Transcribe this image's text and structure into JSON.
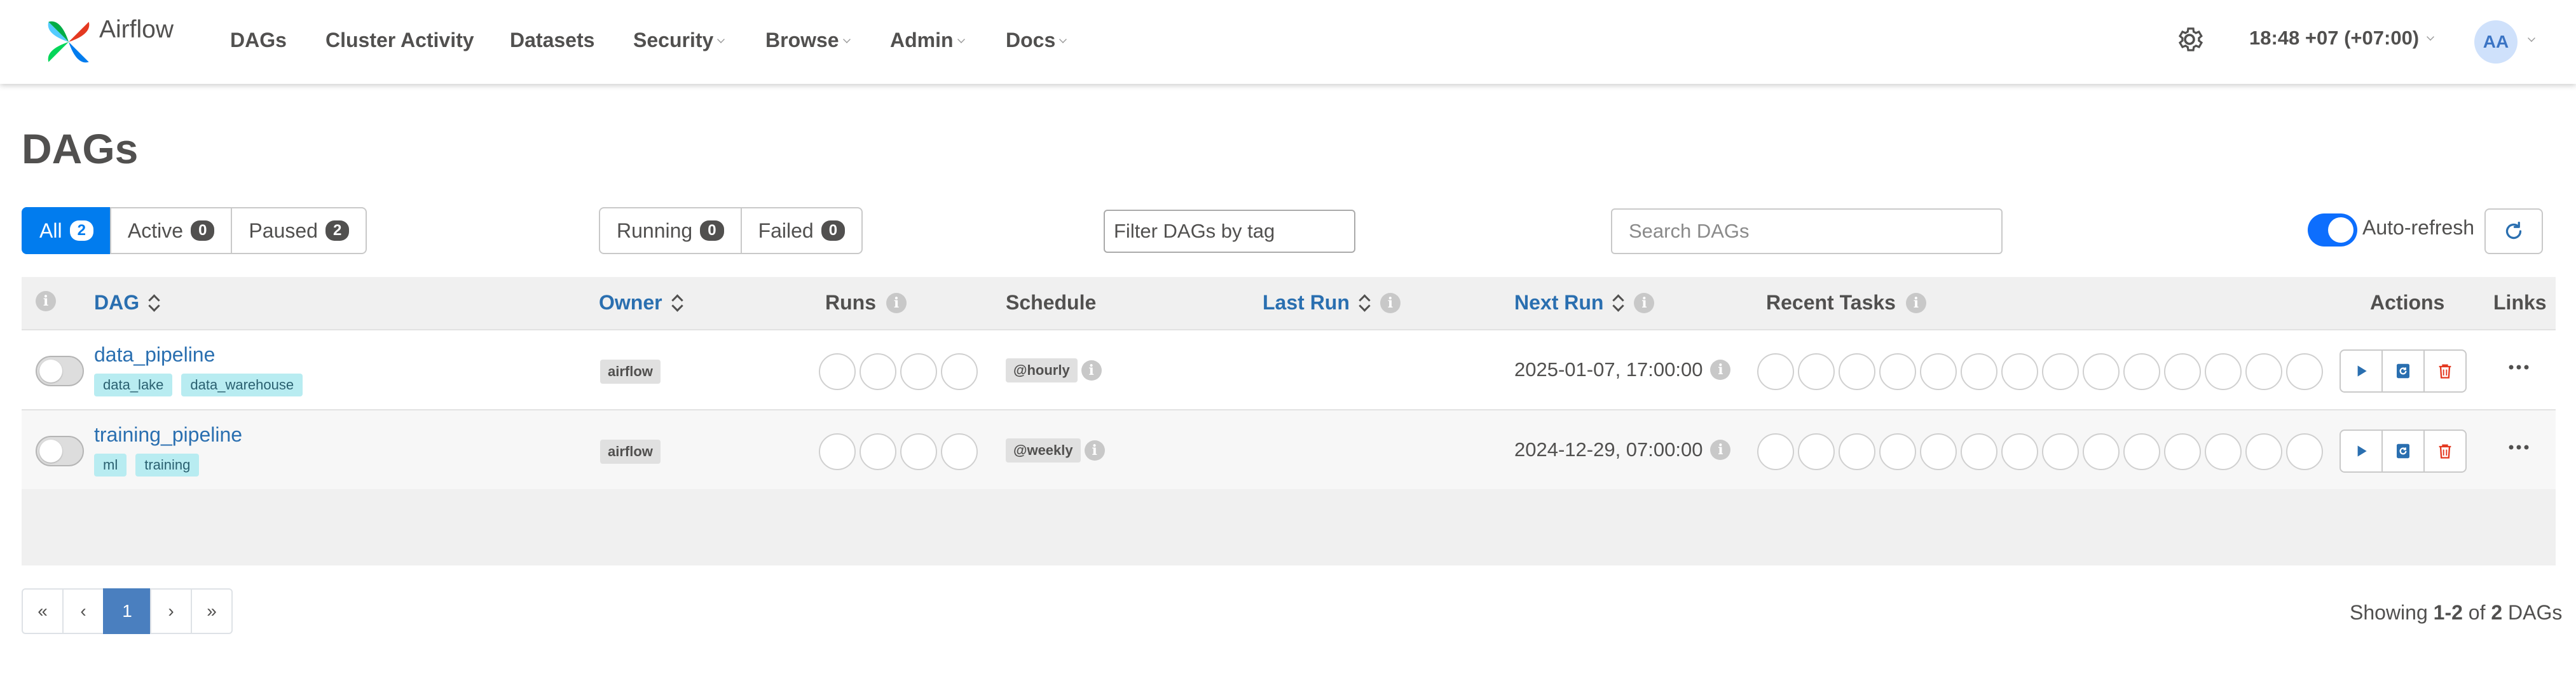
{
  "navbar": {
    "brand": "Airflow",
    "items": [
      {
        "label": "DAGs",
        "dropdown": false
      },
      {
        "label": "Cluster Activity",
        "dropdown": false
      },
      {
        "label": "Datasets",
        "dropdown": false
      },
      {
        "label": "Security",
        "dropdown": true
      },
      {
        "label": "Browse",
        "dropdown": true
      },
      {
        "label": "Admin",
        "dropdown": true
      },
      {
        "label": "Docs",
        "dropdown": true
      }
    ],
    "clock": "18:48 +07 (+07:00)",
    "user_initials": "AA"
  },
  "page_title": "DAGs",
  "status_filters": [
    {
      "label": "All",
      "count": "2",
      "active": true
    },
    {
      "label": "Active",
      "count": "0",
      "active": false
    },
    {
      "label": "Paused",
      "count": "2",
      "active": false
    }
  ],
  "run_filters": [
    {
      "label": "Running",
      "count": "0"
    },
    {
      "label": "Failed",
      "count": "0"
    }
  ],
  "tag_filter": {
    "placeholder": "Filter DAGs by tag"
  },
  "search": {
    "placeholder": "Search DAGs"
  },
  "auto_refresh": {
    "label": "Auto-refresh",
    "enabled": true
  },
  "table": {
    "headers": {
      "dag": "DAG",
      "owner": "Owner",
      "runs": "Runs",
      "schedule": "Schedule",
      "last_run": "Last Run",
      "next_run": "Next Run",
      "recent_tasks": "Recent Tasks",
      "actions": "Actions",
      "links": "Links"
    },
    "rows": [
      {
        "dag_id": "data_pipeline",
        "tags": [
          "data_lake",
          "data_warehouse"
        ],
        "owner": "airflow",
        "schedule": "@hourly",
        "last_run": "",
        "next_run": "2025-01-07, 17:00:00",
        "paused": true
      },
      {
        "dag_id": "training_pipeline",
        "tags": [
          "ml",
          "training"
        ],
        "owner": "airflow",
        "schedule": "@weekly",
        "last_run": "",
        "next_run": "2024-12-29, 07:00:00",
        "paused": true
      }
    ]
  },
  "pagination": {
    "first": "«",
    "prev": "‹",
    "current": "1",
    "next": "›",
    "last": "»",
    "showing_prefix": "Showing",
    "showing_range": "1-2",
    "showing_of": "of",
    "showing_total": "2",
    "showing_suffix": "DAGs"
  },
  "colors": {
    "accent": "#017cee",
    "link": "#2a6fb0",
    "tag_bg": "#b8ecf1",
    "delete": "#e43921"
  }
}
